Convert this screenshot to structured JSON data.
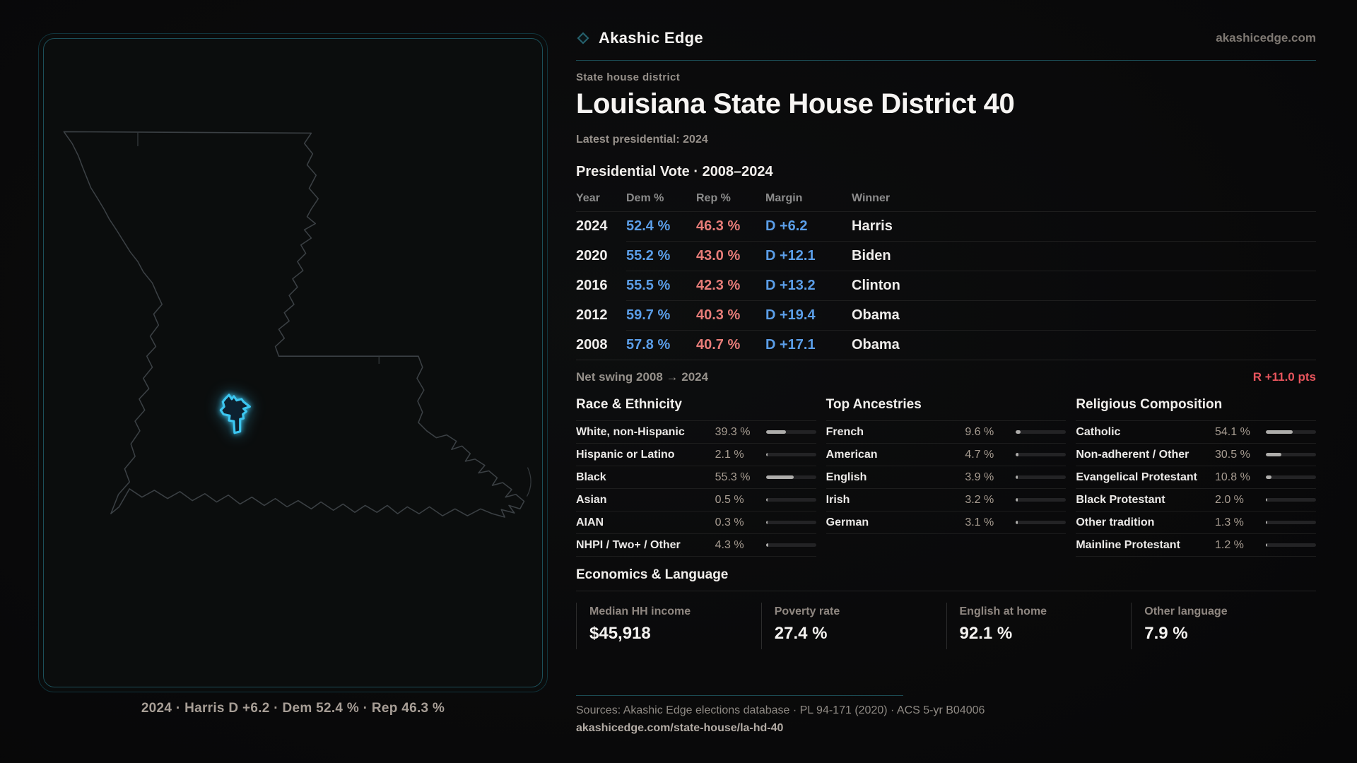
{
  "brand": {
    "name": "Akashic Edge",
    "diamond_icon": "diamond-outline",
    "domain": "akashicedge.com"
  },
  "header": {
    "kicker": "State house district",
    "title": "Louisiana State House District 40",
    "latest": "Latest presidential: 2024"
  },
  "election": {
    "title": "Presidential Vote · 2008–2024",
    "columns": [
      "Year",
      "Dem %",
      "Rep %",
      "Margin",
      "Winner"
    ],
    "rows": [
      [
        "2024",
        "52.4 %",
        "46.3 %",
        "D +6.2",
        "Harris"
      ],
      [
        "2020",
        "55.2 %",
        "43.0 %",
        "D +12.1",
        "Biden"
      ],
      [
        "2016",
        "55.5 %",
        "42.3 %",
        "D +13.2",
        "Clinton"
      ],
      [
        "2012",
        "59.7 %",
        "40.3 %",
        "D +19.4",
        "Obama"
      ],
      [
        "2008",
        "57.8 %",
        "40.7 %",
        "D +17.1",
        "Obama"
      ]
    ],
    "net_swing_label": "Net swing 2008 → 2024",
    "net_swing_value": "R +11.0 pts"
  },
  "demographics": [
    {
      "title": "Race & Ethnicity",
      "rows": [
        {
          "label": "White, non-Hispanic",
          "value": "39.3 %",
          "pct": 39.3
        },
        {
          "label": "Hispanic or Latino",
          "value": "2.1 %",
          "pct": 2.1
        },
        {
          "label": "Black",
          "value": "55.3 %",
          "pct": 55.3
        },
        {
          "label": "Asian",
          "value": "0.5 %",
          "pct": 0.5
        },
        {
          "label": "AIAN",
          "value": "0.3 %",
          "pct": 0.3
        },
        {
          "label": "NHPI / Two+ / Other",
          "value": "4.3 %",
          "pct": 4.3
        }
      ]
    },
    {
      "title": "Top Ancestries",
      "rows": [
        {
          "label": "French",
          "value": "9.6 %",
          "pct": 9.6
        },
        {
          "label": "American",
          "value": "4.7 %",
          "pct": 4.7
        },
        {
          "label": "English",
          "value": "3.9 %",
          "pct": 3.9
        },
        {
          "label": "Irish",
          "value": "3.2 %",
          "pct": 3.2
        },
        {
          "label": "German",
          "value": "3.1 %",
          "pct": 3.1
        }
      ]
    },
    {
      "title": "Religious Composition",
      "rows": [
        {
          "label": "Catholic",
          "value": "54.1 %",
          "pct": 54.1
        },
        {
          "label": "Non-adherent / Other",
          "value": "30.5 %",
          "pct": 30.5
        },
        {
          "label": "Evangelical Protestant",
          "value": "10.8 %",
          "pct": 10.8
        },
        {
          "label": "Black Protestant",
          "value": "2.0 %",
          "pct": 2.0
        },
        {
          "label": "Other tradition",
          "value": "1.3 %",
          "pct": 1.3
        },
        {
          "label": "Mainline Protestant",
          "value": "1.2 %",
          "pct": 1.2
        }
      ]
    }
  ],
  "economics": {
    "title": "Economics & Language",
    "stats": [
      {
        "label": "Median HH income",
        "value": "$45,918"
      },
      {
        "label": "Poverty rate",
        "value": "27.4 %"
      },
      {
        "label": "English at home",
        "value": "92.1 %"
      },
      {
        "label": "Other language",
        "value": "7.9 %"
      }
    ]
  },
  "map": {
    "caption": "2024 · Harris D +6.2 · Dem 52.4 % · Rep 46.3 %"
  },
  "footer": {
    "sources": "Sources: Akashic Edge elections database · PL 94-171 (2020) · ACS 5-yr B04006",
    "permalink": "akashicedge.com/state-house/la-hd-40"
  },
  "colors": {
    "dem_blue": "#5b9ee8",
    "rep_red": "#e87d79",
    "swing_red": "#e8555d",
    "accent_teal": "#1b4a52",
    "district_cyan": "#3cc6f0",
    "bar_fill": "#aeadab"
  }
}
